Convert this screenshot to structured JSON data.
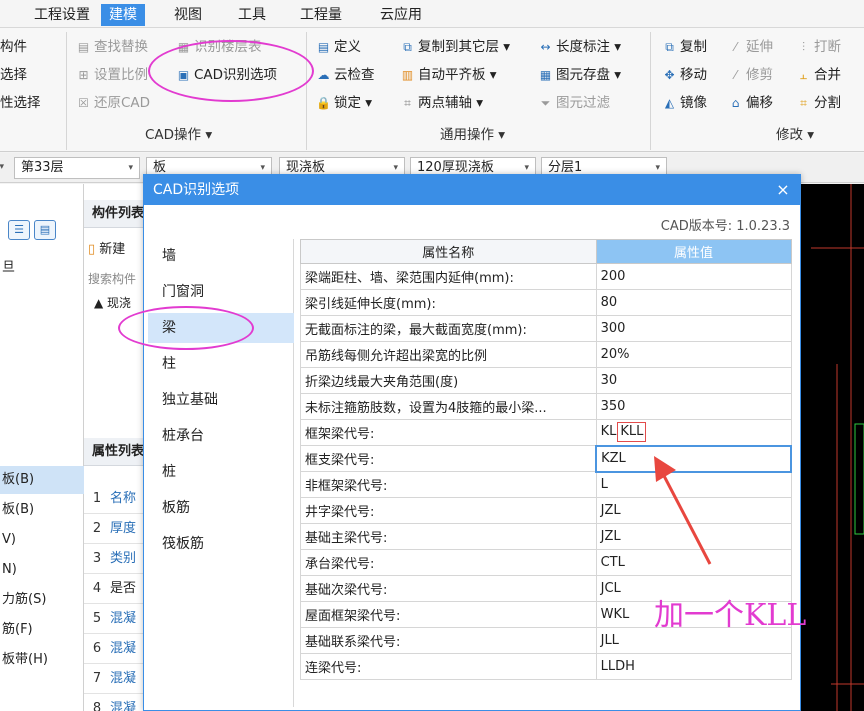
{
  "menu": {
    "items": [
      "工程设置",
      "建模",
      "视图",
      "工具",
      "工程量",
      "云应用"
    ],
    "active_index": 1
  },
  "ribbon": {
    "left_partial": [
      "构件",
      "选择",
      "性选择"
    ],
    "cad_ops": {
      "items": [
        "查找替换",
        "识别楼层表",
        "设置比例",
        "CAD识别选项",
        "还原CAD"
      ],
      "group_label": "CAD操作 ▾"
    },
    "common_ops": {
      "items": [
        "定义",
        "复制到其它层 ▾",
        "长度标注 ▾",
        "云检查",
        "自动平齐板 ▾",
        "图元存盘 ▾",
        "锁定 ▾",
        "两点辅轴 ▾",
        "图元过滤"
      ],
      "group_label": "通用操作 ▾"
    },
    "modify": {
      "items": [
        "复制",
        "延伸",
        "打断",
        "移动",
        "修剪",
        "合并",
        "镜像",
        "偏移",
        "分割"
      ],
      "group_label": "修改 ▾"
    }
  },
  "toolbar": {
    "floor": "第33层",
    "combo2": "板",
    "combo3": "现浇板",
    "combo4": "120厚现浇板",
    "combo5": "分层1"
  },
  "left_panel": {
    "top_label": "旦",
    "items": [
      "板(B)",
      "板(B)",
      "V)",
      "N)",
      "力筋(S)",
      "筋(F)",
      "板带(H)"
    ],
    "selected_index": 0
  },
  "mid_panel": {
    "list_header": "构件列表",
    "new_label": "新建",
    "search_placeholder": "搜索构件",
    "tree_node": "▲ 现浇",
    "props_header": "属性列表",
    "rows": [
      {
        "num": "1",
        "text": "名称"
      },
      {
        "num": "2",
        "text": "厚度"
      },
      {
        "num": "3",
        "text": "类别"
      },
      {
        "num": "4",
        "text": "是否"
      },
      {
        "num": "5",
        "text": "混凝"
      },
      {
        "num": "6",
        "text": "混凝"
      },
      {
        "num": "7",
        "text": "混凝"
      },
      {
        "num": "8",
        "text": "混凝"
      }
    ]
  },
  "dialog": {
    "title": "CAD识别选项",
    "close": "×",
    "version": "CAD版本号: 1.0.23.3",
    "categories": [
      "墙",
      "门窗洞",
      "梁",
      "柱",
      "独立基础",
      "桩承台",
      "桩",
      "板筋",
      "筏板筋"
    ],
    "selected_category": 2,
    "table": {
      "header_name": "属性名称",
      "header_value": "属性值",
      "rows": [
        {
          "name": "梁端距柱、墙、梁范围内延伸(mm):",
          "value": "200"
        },
        {
          "name": "梁引线延伸长度(mm):",
          "value": "80"
        },
        {
          "name": "无截面标注的梁，最大截面宽度(mm):",
          "value": "300"
        },
        {
          "name": "吊筋线每侧允许超出梁宽的比例",
          "value": "20%"
        },
        {
          "name": "折梁边线最大夹角范围(度)",
          "value": "30"
        },
        {
          "name": "未标注箍筋肢数，设置为4肢箍的最小梁...",
          "value": "350"
        },
        {
          "name": "框架梁代号:",
          "value": "KL",
          "value_extra": "KLL"
        },
        {
          "name": "框支梁代号:",
          "value": "KZL"
        },
        {
          "name": "非框架梁代号:",
          "value": "L"
        },
        {
          "name": "井字梁代号:",
          "value": "JZL"
        },
        {
          "name": "基础主梁代号:",
          "value": "JZL"
        },
        {
          "name": "承台梁代号:",
          "value": "CTL"
        },
        {
          "name": "基础次梁代号:",
          "value": "JCL"
        },
        {
          "name": "屋面框架梁代号:",
          "value": "WKL"
        },
        {
          "name": "基础联系梁代号:",
          "value": "JLL"
        },
        {
          "name": "连梁代号:",
          "value": "LLDH"
        }
      ]
    }
  },
  "annotation": {
    "text": "加一个KLL",
    "color": "#e23bd0"
  }
}
